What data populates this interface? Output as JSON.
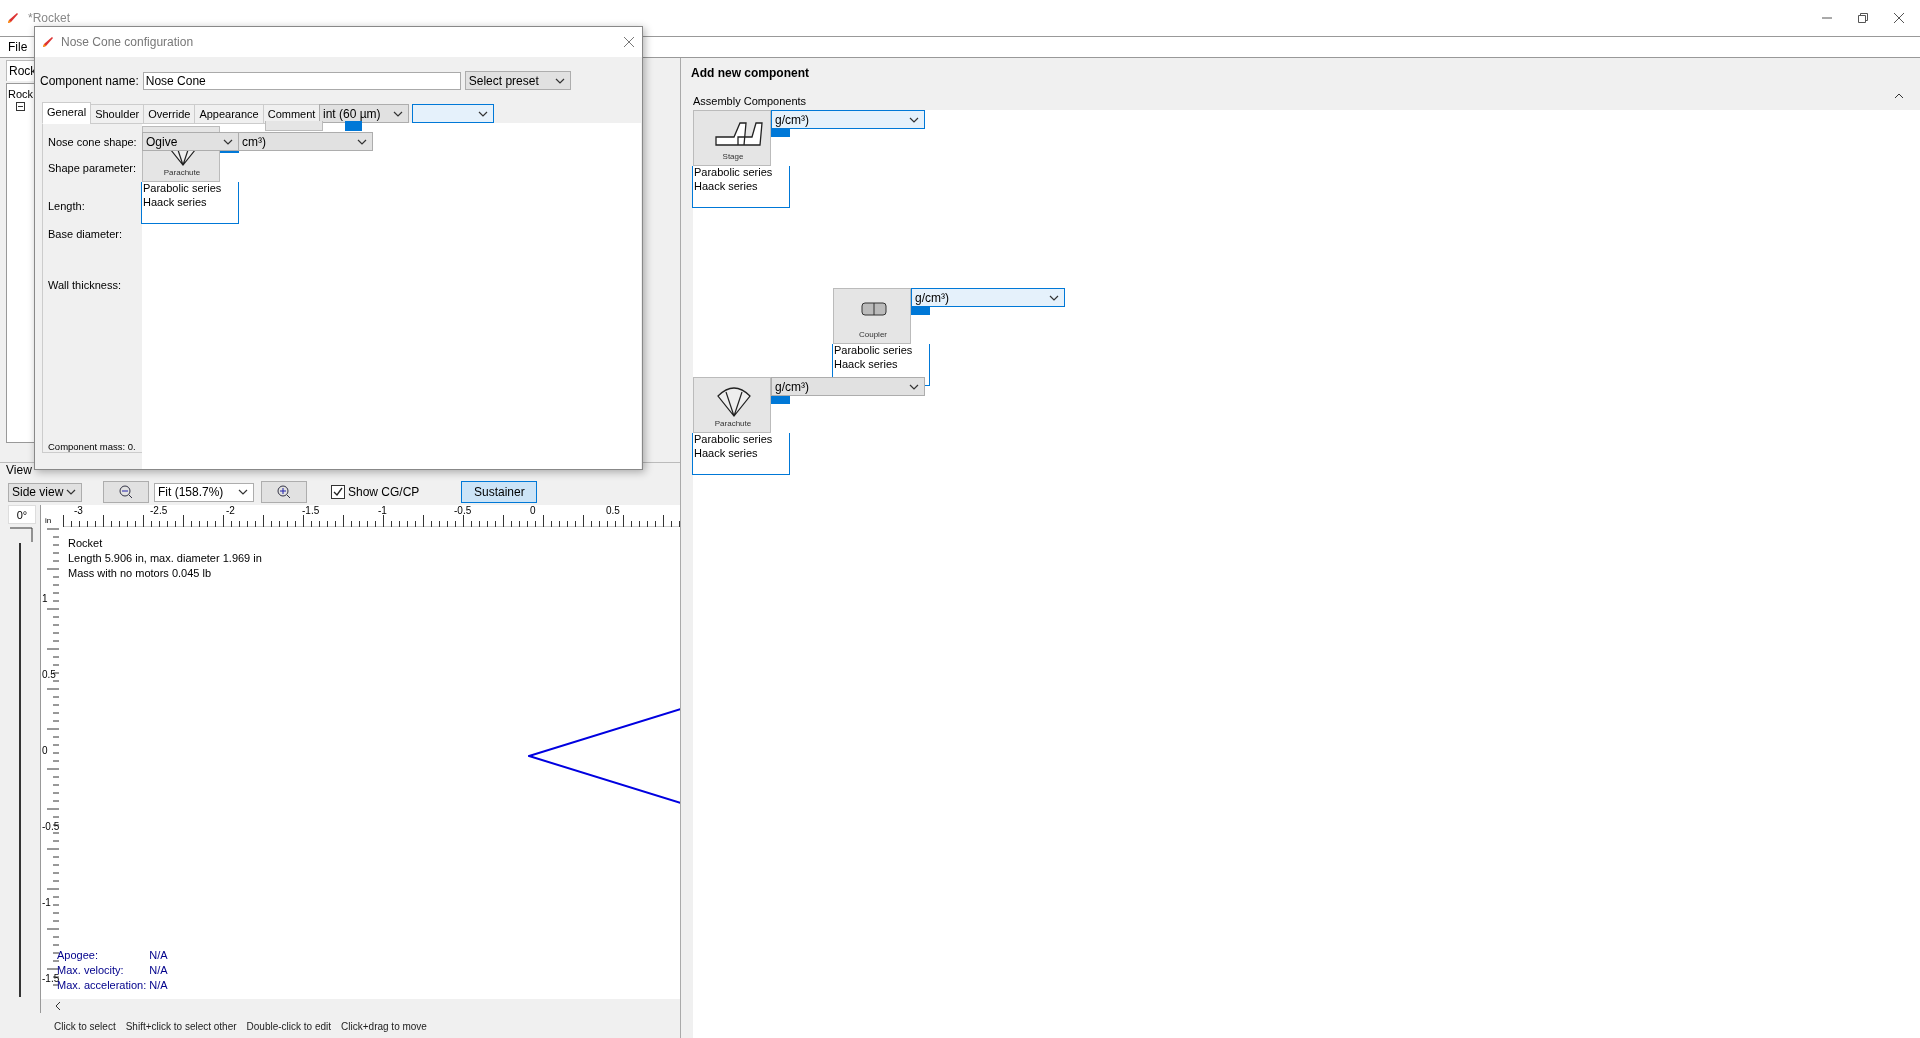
{
  "window": {
    "title": "*Rocket"
  },
  "menu": [
    "File"
  ],
  "main": {
    "tab": "Rock",
    "tree_root": "Rock",
    "view_label": "View",
    "view_type": "Side view",
    "zoom": "Fit (158.7%)",
    "show_cgcp": {
      "label": "Show CG/CP",
      "checked": true
    },
    "stage_button": {
      "label": "Sustainer",
      "selected": true
    },
    "angle": "0°",
    "angle_slider": {
      "level": 1
    },
    "unit": "in",
    "xticks": [
      "-3",
      "-2.5",
      "-2",
      "-1.5",
      "-1",
      "-0.5",
      "0",
      "0.5"
    ],
    "yticks": [
      "1",
      "0.5",
      "0",
      "-0.5",
      "-1",
      "-1.5"
    ],
    "info": [
      "Rocket",
      "Length 5.906 in, max. diameter 1.969 in",
      "Mass with no motors 0.045 lb"
    ],
    "stats": [
      {
        "label": "Apogee:",
        "value": "N/A"
      },
      {
        "label": "Max. velocity:",
        "value": "N/A"
      },
      {
        "label": "Max. acceleration:",
        "value": "N/A"
      }
    ],
    "hints": [
      "Click to select",
      "Shift+click to select other",
      "Double-click to edit",
      "Click+drag to move"
    ]
  },
  "right": {
    "frame_title": "Add new component",
    "section": "Assembly Components",
    "cards": [
      {
        "kind": "stage",
        "caption": "Stage",
        "dropdown": "g/cm³)",
        "focused": true,
        "items": [
          "Parabolic series",
          "Haack series"
        ]
      },
      {
        "kind": "coupler",
        "caption": "Coupler",
        "dropdown": "g/cm³)",
        "focused": true,
        "items": [
          "Parabolic series",
          "Haack series"
        ]
      },
      {
        "kind": "parachute",
        "caption": "Parachute",
        "dropdown": "g/cm³)",
        "focused": false,
        "items": [
          "Parabolic series",
          "Haack series"
        ]
      }
    ]
  },
  "dialog": {
    "title": "Nose Cone configuration",
    "name_label": "Component name:",
    "name_value": "Nose Cone",
    "preset": "Select preset",
    "tabs": [
      {
        "label": "General",
        "selected": true
      },
      {
        "label": "Shoulder",
        "selected": false
      },
      {
        "label": "Override",
        "selected": false
      },
      {
        "label": "Appearance",
        "selected": false
      },
      {
        "label": "Comment",
        "selected": false
      }
    ],
    "finish_dropdown": "int (60 µm)",
    "labels": [
      "Nose cone shape:",
      "Shape parameter:",
      "Length:",
      "Base diameter:",
      "Wall thickness:"
    ],
    "shape": "Ogive",
    "material_dropdown": "cm³)",
    "card": {
      "kind": "parachute",
      "caption": "Parachute",
      "items": [
        "Parabolic series",
        "Haack series"
      ]
    },
    "mass": "Component mass: 0."
  }
}
